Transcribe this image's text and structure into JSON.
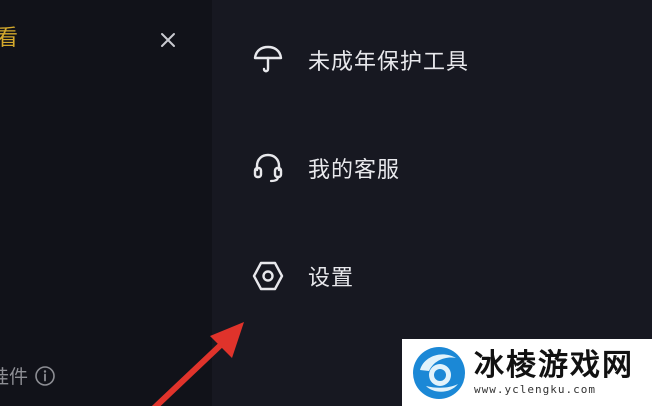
{
  "left_panel": {
    "title_fragment": "看",
    "footer_label": "挂件",
    "icons": {
      "close": "close-icon",
      "info": "info-icon"
    }
  },
  "menu": {
    "items": [
      {
        "label": "未成年保护工具",
        "icon": "umbrella-icon"
      },
      {
        "label": "我的客服",
        "icon": "headset-icon"
      },
      {
        "label": "设置",
        "icon": "settings-gear-icon"
      }
    ]
  },
  "annotation": {
    "arrow_color": "#e0332b"
  },
  "watermark": {
    "title": "冰棱游戏网",
    "url": "www.yclengku.com",
    "logo_colors": [
      "#1b88d6",
      "#e2f3fb"
    ]
  },
  "colors": {
    "left_panel_bg": "#111219",
    "right_panel_bg": "#171821",
    "title_accent": "#d4a92c",
    "menu_text": "#e8e8ec",
    "muted_text": "#8d8e94"
  }
}
